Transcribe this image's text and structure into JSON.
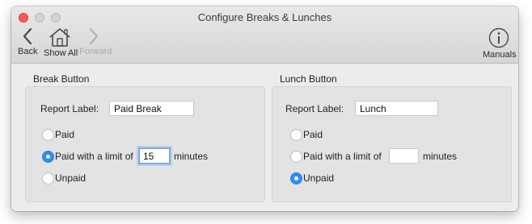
{
  "window": {
    "title": "Configure Breaks & Lunches"
  },
  "toolbar": {
    "back": {
      "label": "Back",
      "icon": "chevron-left-icon"
    },
    "show_all": {
      "label": "Show All",
      "icon": "home-icon"
    },
    "forward": {
      "label": "Forward",
      "icon": "chevron-right-icon",
      "enabled": false
    },
    "manuals": {
      "label": "Manuals",
      "icon": "info-icon"
    }
  },
  "break": {
    "title": "Break Button",
    "report_label_caption": "Report Label:",
    "report_label_value": "Paid Break",
    "options": {
      "paid": "Paid",
      "paid_limit": "Paid with a limit of",
      "unpaid": "Unpaid"
    },
    "limit_value": "15",
    "minutes_label": "minutes",
    "selected": "paid_limit"
  },
  "lunch": {
    "title": "Lunch Button",
    "report_label_caption": "Report Label:",
    "report_label_value": "Lunch",
    "options": {
      "paid": "Paid",
      "paid_limit": "Paid with a limit of",
      "unpaid": "Unpaid"
    },
    "limit_value": "",
    "minutes_label": "minutes",
    "selected": "unpaid"
  },
  "colors": {
    "accent": "#2f8ef4",
    "close": "#fc5b57",
    "focus_ring": "#7aa8e8"
  }
}
